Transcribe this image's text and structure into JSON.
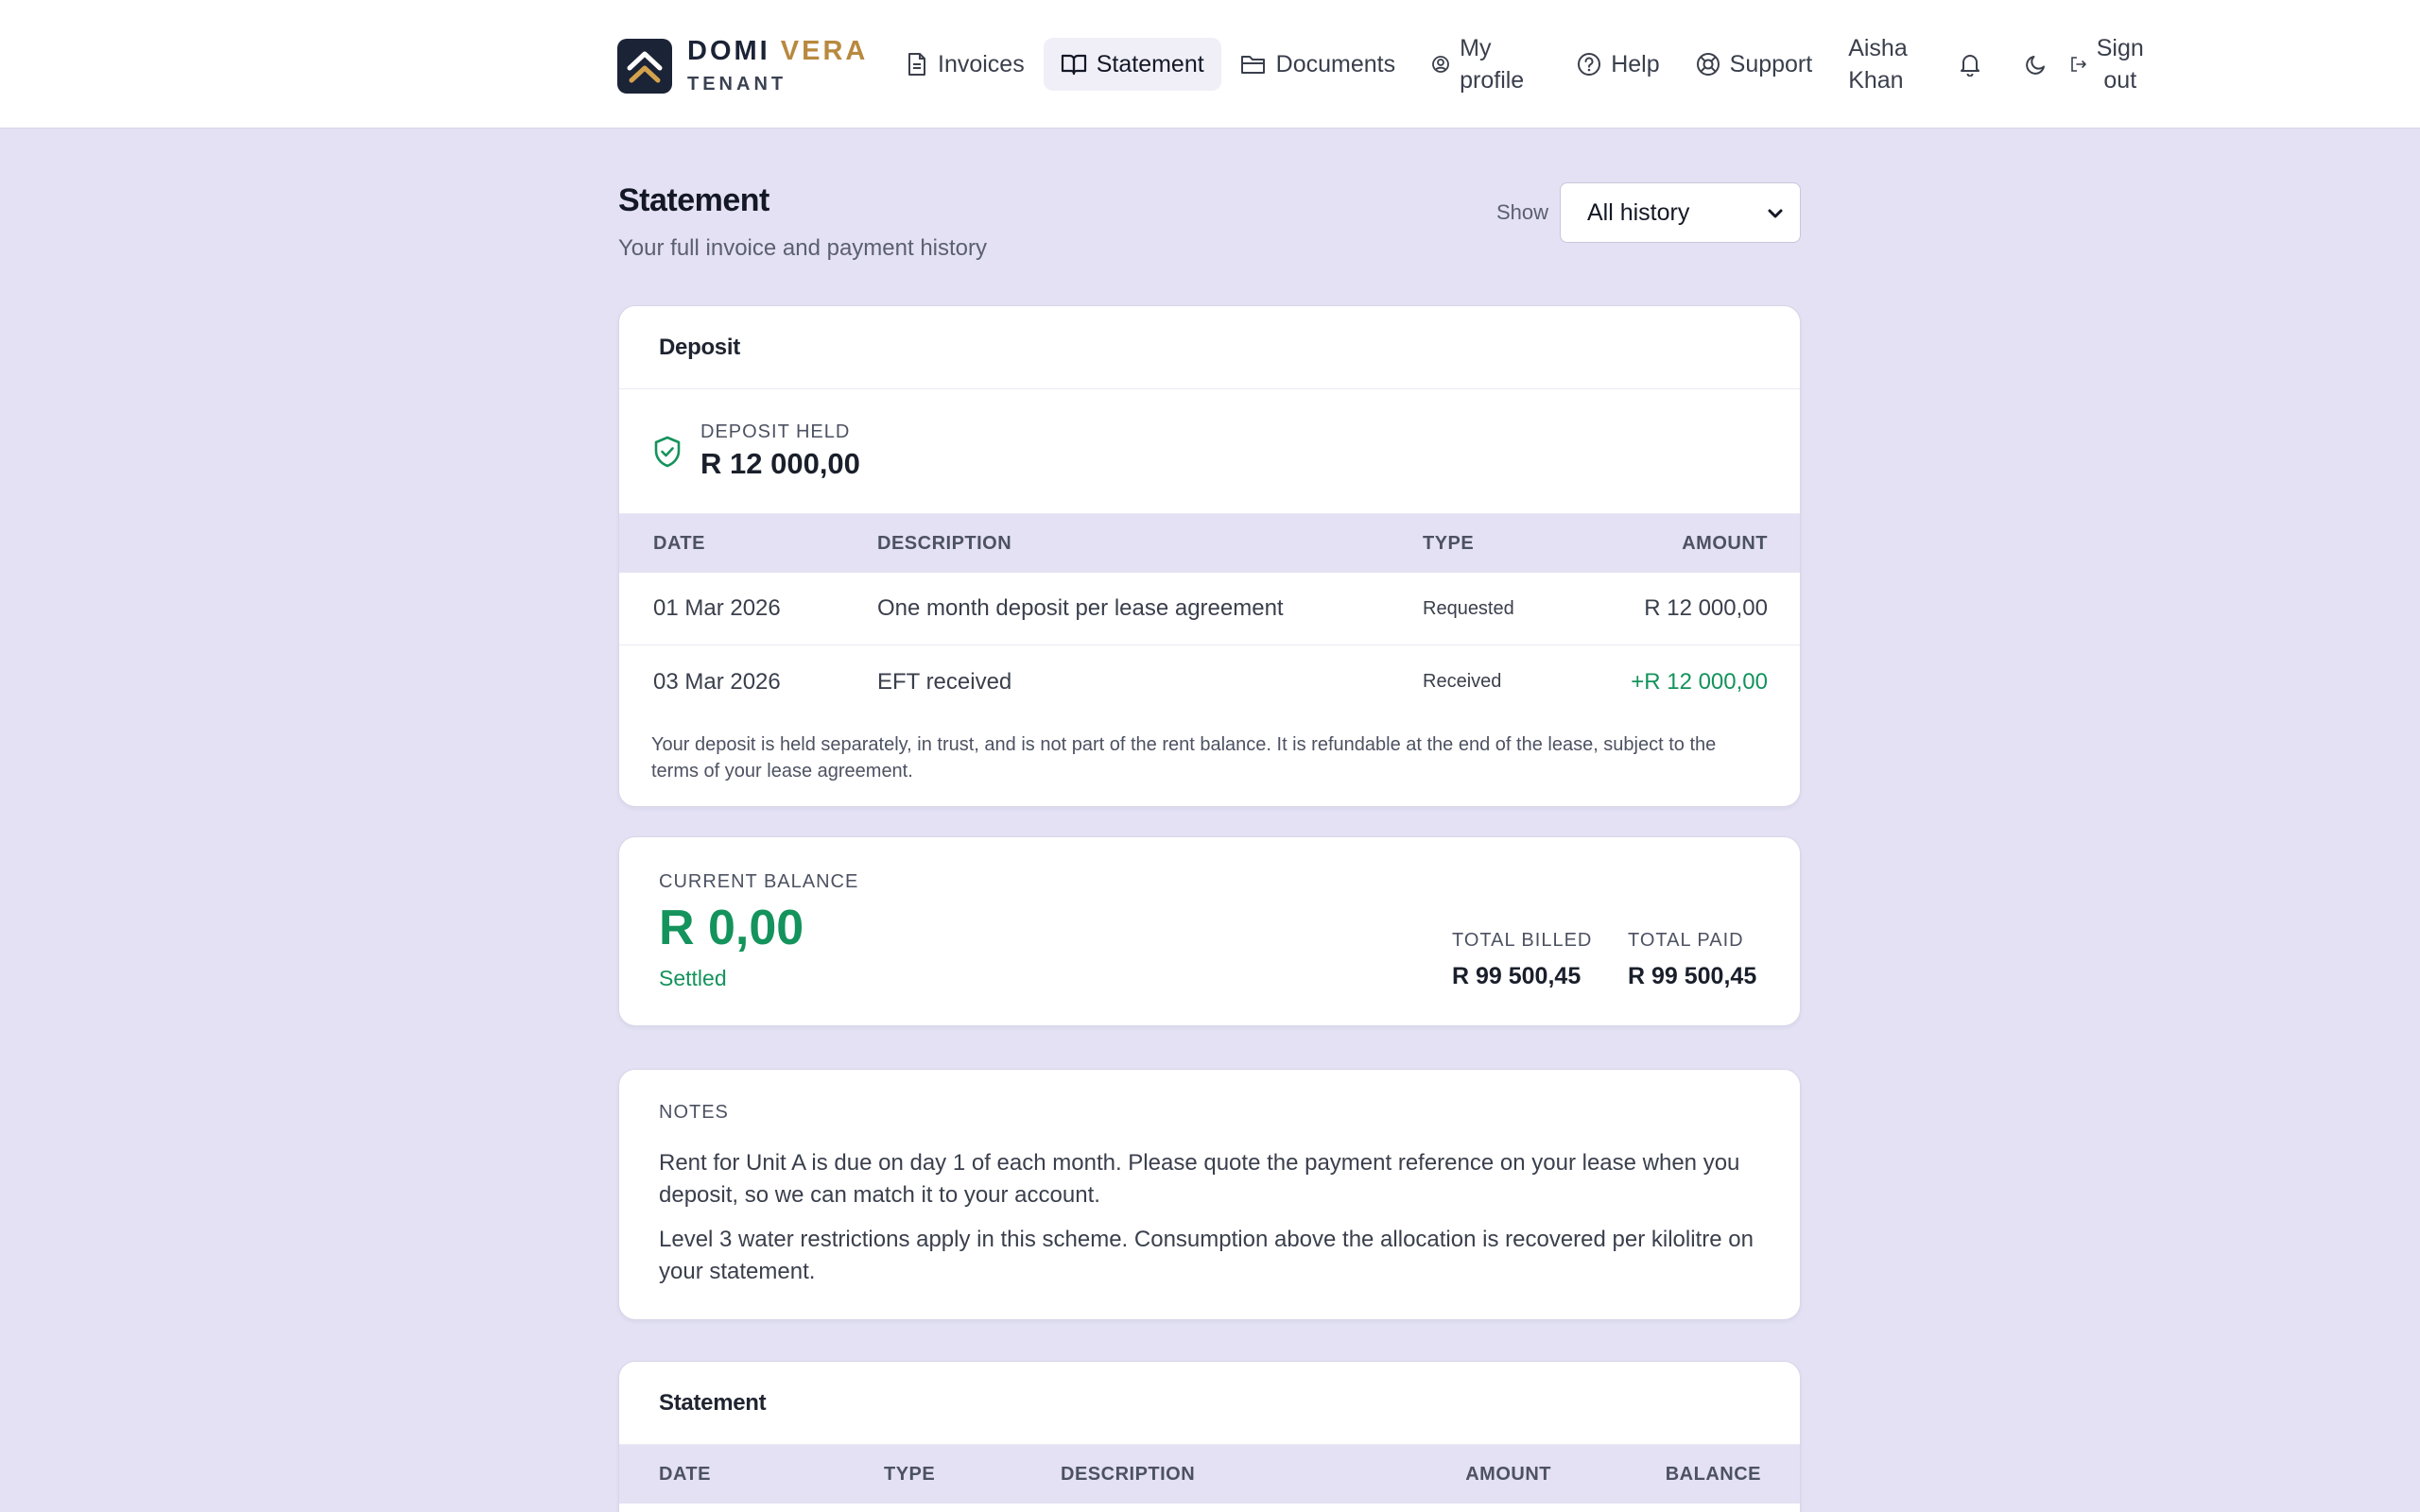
{
  "brand": {
    "name_part1": "DOMI",
    "name_part2": "VERA",
    "subtitle": "TENANT"
  },
  "nav": {
    "invoices": "Invoices",
    "statement": "Statement",
    "documents": "Documents",
    "profile_line1": "My",
    "profile_line2": "profile",
    "help": "Help",
    "support": "Support",
    "user_line1": "Aisha",
    "user_line2": "Khan",
    "signout_line1": "Sign",
    "signout_line2": "out"
  },
  "page": {
    "title": "Statement",
    "subtitle": "Your full invoice and payment history",
    "show_label": "Show",
    "filter_value": "All history"
  },
  "deposit": {
    "title": "Deposit",
    "held_label": "DEPOSIT HELD",
    "held_value": "R 12 000,00",
    "columns": {
      "date": "DATE",
      "description": "DESCRIPTION",
      "type": "TYPE",
      "amount": "AMOUNT"
    },
    "rows": [
      {
        "date": "01 Mar 2026",
        "description": "One month deposit per lease agreement",
        "type": "Requested",
        "amount": "R 12 000,00"
      },
      {
        "date": "03 Mar 2026",
        "description": "EFT received",
        "type": "Received",
        "amount": "+R 12 000,00"
      }
    ],
    "note": "Your deposit is held separately, in trust, and is not part of the rent balance. It is refundable at the end of the lease, subject to the terms of your lease agreement."
  },
  "balance": {
    "label": "CURRENT BALANCE",
    "value": "R 0,00",
    "status": "Settled",
    "total_billed_label": "TOTAL BILLED",
    "total_billed_value": "R 99 500,45",
    "total_paid_label": "TOTAL PAID",
    "total_paid_value": "R 99 500,45"
  },
  "notes": {
    "label": "NOTES",
    "paragraphs": [
      "Rent for Unit A is due on day 1 of each month. Please quote the payment reference on your lease when you deposit, so we can match it to your account.",
      "Level 3 water restrictions apply in this scheme. Consumption above the allocation is recovered per kilolitre on your statement."
    ]
  },
  "statement": {
    "title": "Statement",
    "columns": {
      "date": "DATE",
      "type": "TYPE",
      "description": "DESCRIPTION",
      "amount": "AMOUNT",
      "balance": "BALANCE"
    }
  },
  "colors": {
    "accent_gold": "#b8893f",
    "positive_green": "#14935c",
    "page_bg": "#e3e1f3",
    "logo_bg": "#1b2336"
  },
  "icons": {
    "invoices": "document-icon",
    "statement": "book-icon",
    "documents": "folder-icon",
    "profile": "user-circle-icon",
    "help": "help-circle-icon",
    "support": "lifebuoy-icon",
    "notifications": "bell-icon",
    "theme": "moon-icon",
    "signout": "logout-icon",
    "deposit": "shield-check-icon"
  }
}
